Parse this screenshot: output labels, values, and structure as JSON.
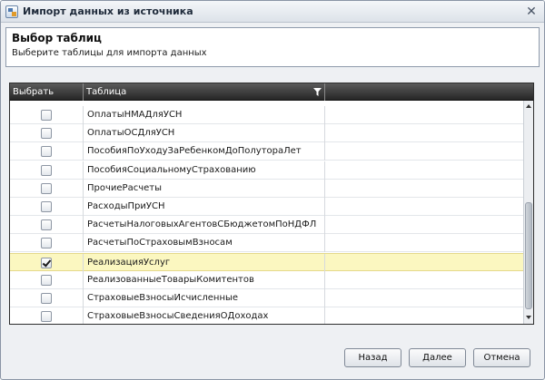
{
  "window": {
    "title": "Импорт данных из источника",
    "close_glyph": "✕"
  },
  "header": {
    "title": "Выбор таблиц",
    "subtitle": "Выберите таблицы для импорта данных"
  },
  "grid": {
    "columns": {
      "select": "Выбрать",
      "table": "Таблица"
    },
    "rows": [
      {
        "name": "ОплатыНМАДляУСН",
        "checked": false
      },
      {
        "name": "ОплатыОСДляУСН",
        "checked": false
      },
      {
        "name": "ПособияПоУходуЗаРебенкомДоПолутораЛет",
        "checked": false
      },
      {
        "name": "ПособияСоциальномуСтрахованию",
        "checked": false
      },
      {
        "name": "ПрочиеРасчеты",
        "checked": false
      },
      {
        "name": "РасходыПриУСН",
        "checked": false
      },
      {
        "name": "РасчетыНалоговыхАгентовСБюджетомПоНДФЛ",
        "checked": false
      },
      {
        "name": "РасчетыПоСтраховымВзносам",
        "checked": false
      },
      {
        "name": "РеализацияУслуг",
        "checked": true,
        "selected": true
      },
      {
        "name": "РеализованныеТоварыКомитентов",
        "checked": false
      },
      {
        "name": "СтраховыеВзносыИсчисленные",
        "checked": false
      },
      {
        "name": "СтраховыеВзносыСведенияОДоходах",
        "checked": false
      }
    ]
  },
  "buttons": {
    "back": "Назад",
    "next": "Далее",
    "cancel": "Отмена"
  },
  "icons": {
    "app": "app-window-icon",
    "filter": "filter-icon",
    "close": "close-icon",
    "check": "checkmark-icon"
  },
  "colors": {
    "selected_row": "#fbf7c0",
    "header_bg": "#3a3a3a",
    "window_bg": "#eef0f3"
  }
}
